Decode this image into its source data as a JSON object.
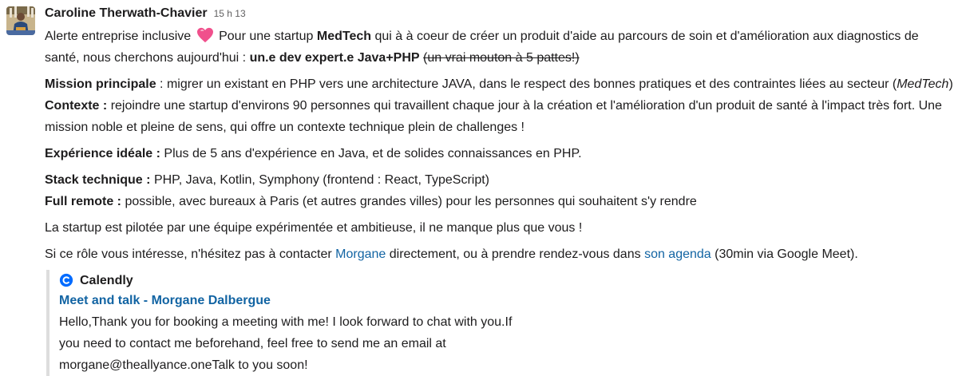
{
  "message": {
    "author": "Caroline Therwath-Chavier",
    "timestamp": "15 h 13",
    "intro": {
      "t1": "Alerte entreprise inclusive",
      "t2": "Pour une startup",
      "company": "MedTech",
      "t3": "qui à à coeur de créer un produit d'aide au parcours de soin et d'amélioration aux diagnostics de santé, nous cherchons aujourd'hui :",
      "role": "un.e dev expert.e Java+PHP",
      "strike": "(un vrai mouton à 5 pattes!)"
    },
    "mission": {
      "label": "Mission principale",
      "text": ": migrer un existant en PHP vers une architecture JAVA, dans le respect des bonnes pratiques et des contraintes liées au secteur (",
      "italic": "MedTech",
      "end": ")"
    },
    "context": {
      "label": "Contexte :",
      "text": "rejoindre une startup d'environs 90 personnes qui travaillent chaque jour à la création et l'amélioration d'un produit de santé à l'impact très fort. Une mission noble et pleine de sens, qui offre un contexte technique plein de challenges !"
    },
    "experience": {
      "label": "Expérience idéale :",
      "text": "Plus de 5 ans d'expérience en Java, et de solides connaissances en PHP."
    },
    "stack": {
      "label": "Stack technique :",
      "text": "PHP, Java, Kotlin, Symphony (frontend : React, TypeScript)"
    },
    "remote": {
      "label": "Full remote :",
      "text": "possible, avec bureaux à Paris (et autres grandes villes) pour les personnes qui souhaitent s'y rendre"
    },
    "closing": "La startup est pilotée par une équipe expérimentée et ambitieuse, il ne manque plus que vous !",
    "contact": {
      "t1": "Si ce rôle vous intéresse, n'hésitez pas à contacter",
      "link1": "Morgane",
      "t2": "directement, ou à prendre rendez-vous dans",
      "link2": "son agenda",
      "t3": "(30min via Google Meet)."
    }
  },
  "unfurl": {
    "service": "Calendly",
    "service_icon": "calendly-icon",
    "title": "Meet and talk - Morgane Dalbergue",
    "desc1": "Hello,Thank you for booking a meeting with me! I look forward to chat with you.If",
    "desc2": "you need to contact me beforehand, feel free to send me an email at",
    "desc3": "morgane@theallyance.oneTalk to you soon!"
  },
  "colors": {
    "link": "#1264a3",
    "heart": "#f0508c",
    "calendly": "#006bff"
  },
  "icons": {
    "heart": "heart-emoji-icon"
  }
}
